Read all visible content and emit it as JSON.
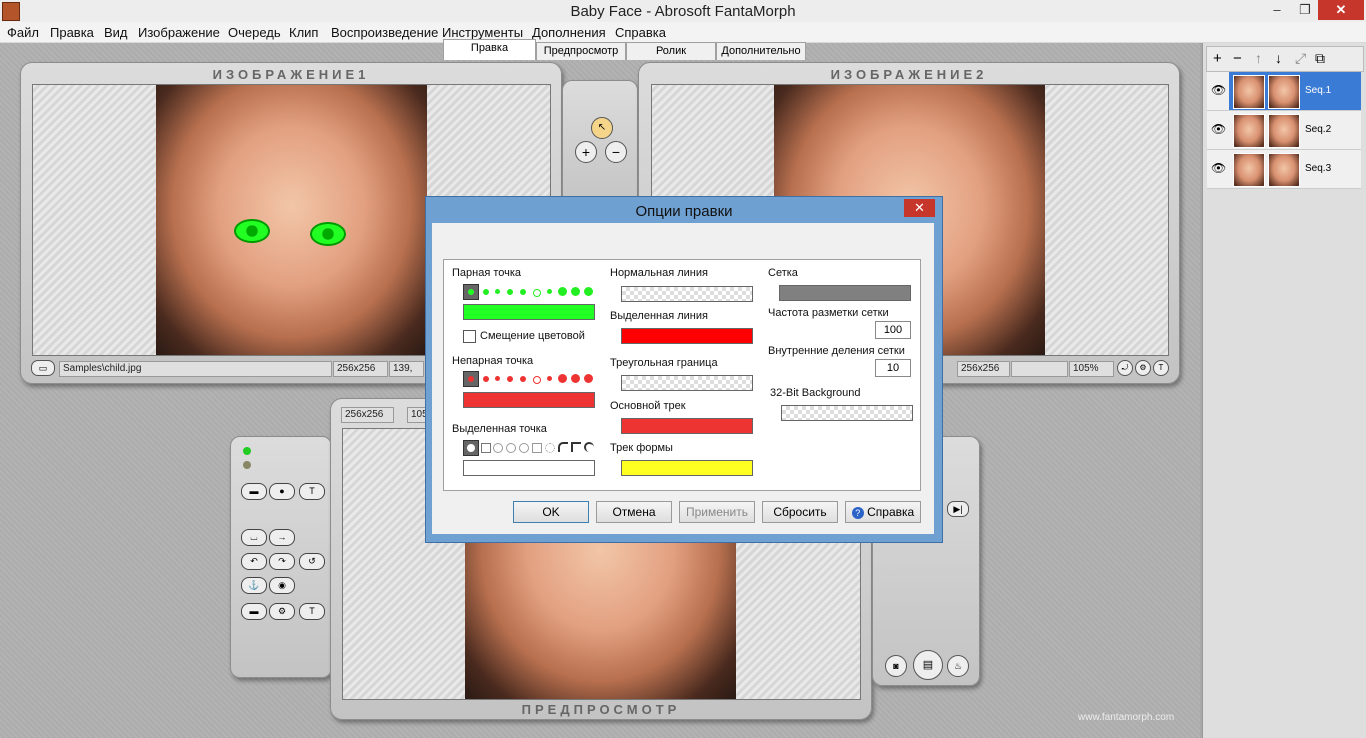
{
  "window": {
    "title": "Baby Face - Abrosoft FantaMorph",
    "minimize": "–",
    "maximize": "❐",
    "close": "✕"
  },
  "menu": [
    "Файл",
    "Правка",
    "Вид",
    "Изображение",
    "Очередь",
    "Клип",
    "Воспроизведение",
    "Инструменты",
    "Дополнения",
    "Справка"
  ],
  "image1": {
    "title": "ИЗОБРАЖЕНИЕ1",
    "path": "Samples\\child.jpg",
    "size": "256x256",
    "coord": "139,"
  },
  "image2": {
    "title": "ИЗОБРАЖЕНИЕ2",
    "size": "256x256",
    "zoom": "105%"
  },
  "preview": {
    "title": "ПРЕДПРОСМОТР",
    "size": "256x256",
    "coord": "105"
  },
  "sequences": [
    {
      "name": "Seq.1",
      "selected": true
    },
    {
      "name": "Seq.2",
      "selected": false
    },
    {
      "name": "Seq.3",
      "selected": false
    }
  ],
  "seq_toolbar": [
    "+",
    "−",
    "↑",
    "↓",
    "⤢",
    "⧉"
  ],
  "dialog": {
    "title": "Опции правки",
    "tabs": [
      "Правка",
      "Предпросмотр",
      "Ролик",
      "Дополнительно"
    ],
    "active_tab": "Правка",
    "col1": {
      "paired_point": "Парная точка",
      "color_offset": "Смещение цветовой",
      "unpaired_point": "Непарная точка",
      "selected_point": "Выделенная точка"
    },
    "col2": {
      "normal_line": "Нормальная линия",
      "selected_line": "Выделенная линия",
      "triangle_border": "Треугольная граница",
      "main_track": "Основной трек",
      "shape_track": "Трек формы"
    },
    "col3": {
      "grid": "Сетка",
      "grid_freq": "Частота разметки сетки",
      "grid_freq_value": "100",
      "grid_inner": "Внутренние деления сетки",
      "grid_inner_value": "10",
      "bg32": "32-Bit Background"
    },
    "buttons": {
      "ok": "OK",
      "cancel": "Отмена",
      "apply": "Применить",
      "reset": "Сбросить",
      "help": "Справка"
    }
  },
  "colors": {
    "paired": "#22ff22",
    "unpaired": "#ee3333",
    "selected_line": "#ff0000",
    "main_track": "#ee3333",
    "shape_track": "#ffff22",
    "grid": "#808080"
  },
  "watermark": "www.fantamorph.com"
}
